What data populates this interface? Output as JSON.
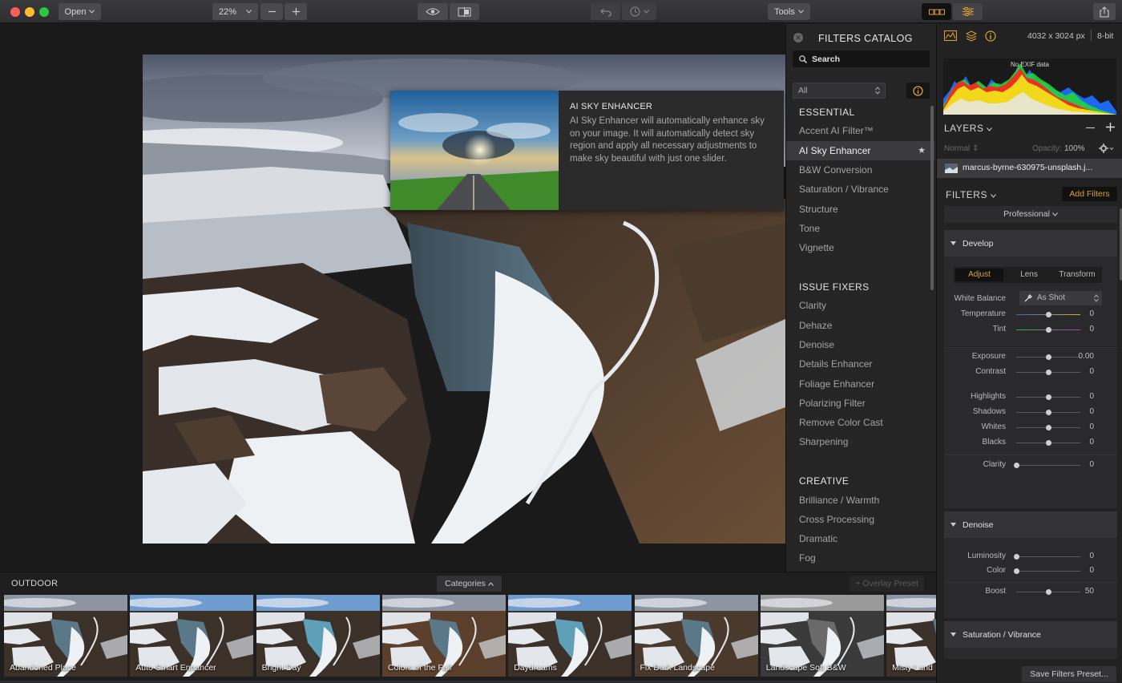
{
  "toolbar": {
    "open_label": "Open",
    "zoom_value": "22%",
    "tools_label": "Tools"
  },
  "tooltip": {
    "title": "AI SKY ENHANCER",
    "description": "AI Sky Enhancer will automatically enhance sky on your image. It will automatically detect sky region and apply all necessary adjustments to make sky beautiful with just one slider."
  },
  "catalog": {
    "title": "FILTERS CATALOG",
    "search_placeholder": "Search",
    "filter_value": "All",
    "sections": [
      {
        "heading": "ESSENTIAL",
        "items": [
          "Accent AI Filter™",
          "AI Sky Enhancer",
          "B&W Conversion",
          "Saturation / Vibrance",
          "Structure",
          "Tone",
          "Vignette"
        ]
      },
      {
        "heading": "ISSUE FIXERS",
        "items": [
          "Clarity",
          "Dehaze",
          "Denoise",
          "Details Enhancer",
          "Foliage Enhancer",
          "Polarizing Filter",
          "Remove Color Cast",
          "Sharpening"
        ]
      },
      {
        "heading": "CREATIVE",
        "items": [
          "Brilliance / Warmth",
          "Cross Processing",
          "Dramatic",
          "Fog"
        ]
      }
    ],
    "selected_item": "AI Sky Enhancer"
  },
  "info": {
    "dimensions": "4032 x 3024 px",
    "bit_depth": "8-bit",
    "exif": "No EXIF data"
  },
  "layers": {
    "title": "LAYERS",
    "blend_mode": "Normal",
    "opacity_label": "Opacity:",
    "opacity_value": "100%",
    "layer_name": "marcus-byrne-630975-unsplash.j..."
  },
  "filters": {
    "title": "FILTERS",
    "add_label": "Add Filters",
    "profile": "Professional",
    "develop": {
      "title": "Develop",
      "tabs": [
        "Adjust",
        "Lens",
        "Transform"
      ],
      "active_tab": "Adjust",
      "white_balance_label": "White Balance",
      "white_balance_value": "As Shot",
      "sliders": [
        {
          "label": "Temperature",
          "value": "0",
          "pos": 0.5
        },
        {
          "label": "Tint",
          "value": "0",
          "pos": 0.5
        },
        {
          "label": "Exposure",
          "value": "0.00",
          "pos": 0.5
        },
        {
          "label": "Contrast",
          "value": "0",
          "pos": 0.5
        },
        {
          "label": "Highlights",
          "value": "0",
          "pos": 0.5
        },
        {
          "label": "Shadows",
          "value": "0",
          "pos": 0.5
        },
        {
          "label": "Whites",
          "value": "0",
          "pos": 0.5
        },
        {
          "label": "Blacks",
          "value": "0",
          "pos": 0.5
        },
        {
          "label": "Clarity",
          "value": "0",
          "pos": 0.0
        }
      ]
    },
    "denoise": {
      "title": "Denoise",
      "sliders": [
        {
          "label": "Luminosity",
          "value": "0",
          "pos": 0.0
        },
        {
          "label": "Color",
          "value": "0",
          "pos": 0.0
        },
        {
          "label": "Boost",
          "value": "50",
          "pos": 0.5
        }
      ]
    },
    "saturation_title": "Saturation / Vibrance",
    "save_label": "Save Filters Preset..."
  },
  "strip": {
    "category": "OUTDOOR",
    "categories_label": "Categories",
    "overlay_label": "+ Overlay Preset",
    "presets": [
      "Abandoned Place",
      "Auto Smart Enhancer",
      "Bright Day",
      "Colors of the Fall",
      "Daydreams",
      "Fix Dark Landscape",
      "Landscape Soft B&W",
      "Misty Land"
    ]
  },
  "colors": {
    "accent": "#e0a030",
    "toolbar_active": "#c88a22"
  }
}
